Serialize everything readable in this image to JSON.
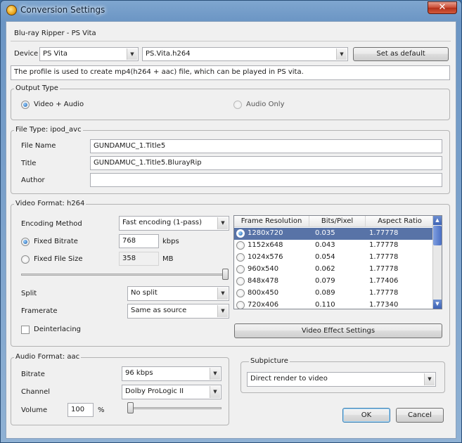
{
  "window": {
    "title": "Conversion Settings",
    "close_glyph": "✕"
  },
  "profile_header": "Blu-ray Ripper - PS Vita",
  "device": {
    "label": "Device",
    "device_value": "PS Vita",
    "profile_value": "PS.Vita.h264",
    "set_default_label": "Set as default"
  },
  "description": "The profile is used to create mp4(h264 + aac) file, which can be played in PS vita.",
  "output_type": {
    "title": "Output Type",
    "video_audio": "Video + Audio",
    "audio_only": "Audio Only"
  },
  "file_type": {
    "title": "File Type: ipod_avc",
    "file_name_label": "File Name",
    "file_name_value": "GUNDAMUC_1.Title5",
    "title_label": "Title",
    "title_value": "GUNDAMUC_1.Title5.BlurayRip",
    "author_label": "Author",
    "author_value": ""
  },
  "video_format": {
    "title": "Video Format: h264",
    "encoding_label": "Encoding Method",
    "encoding_value": "Fast encoding (1-pass)",
    "fixed_bitrate_label": "Fixed Bitrate",
    "fixed_bitrate_value": "768",
    "kbps_unit": "kbps",
    "fixed_size_label": "Fixed File Size",
    "fixed_size_value": "358",
    "mb_unit": "MB",
    "bitrate_slider_level": 1.0,
    "split_label": "Split",
    "split_value": "No split",
    "framerate_label": "Framerate",
    "framerate_value": "Same as source",
    "deinterlacing_label": "Deinterlacing",
    "effect_button": "Video Effect Settings",
    "table": {
      "headers": [
        "Frame Resolution",
        "Bits/Pixel",
        "Aspect Ratio"
      ],
      "rows": [
        {
          "res": "1280x720",
          "bpp": "0.035",
          "aspect": "1.77778"
        },
        {
          "res": "1152x648",
          "bpp": "0.043",
          "aspect": "1.77778"
        },
        {
          "res": "1024x576",
          "bpp": "0.054",
          "aspect": "1.77778"
        },
        {
          "res": "960x540",
          "bpp": "0.062",
          "aspect": "1.77778"
        },
        {
          "res": "848x478",
          "bpp": "0.079",
          "aspect": "1.77406"
        },
        {
          "res": "800x450",
          "bpp": "0.089",
          "aspect": "1.77778"
        },
        {
          "res": "720x406",
          "bpp": "0.110",
          "aspect": "1.77340"
        }
      ],
      "selected_index": 0
    }
  },
  "audio_format": {
    "title": "Audio Format: aac",
    "bitrate_label": "Bitrate",
    "bitrate_value": "96 kbps",
    "channel_label": "Channel",
    "channel_value": "Dolby ProLogic II",
    "volume_label": "Volume",
    "volume_value": "100",
    "volume_unit": "%",
    "volume_slider_level": 0.0
  },
  "subpicture": {
    "title": "Subpicture",
    "value": "Direct render to video"
  },
  "buttons": {
    "ok": "OK",
    "cancel": "Cancel"
  },
  "glyphs": {
    "dropdown_arrow": "▼",
    "scroll_up": "▲",
    "scroll_down": "▼"
  }
}
